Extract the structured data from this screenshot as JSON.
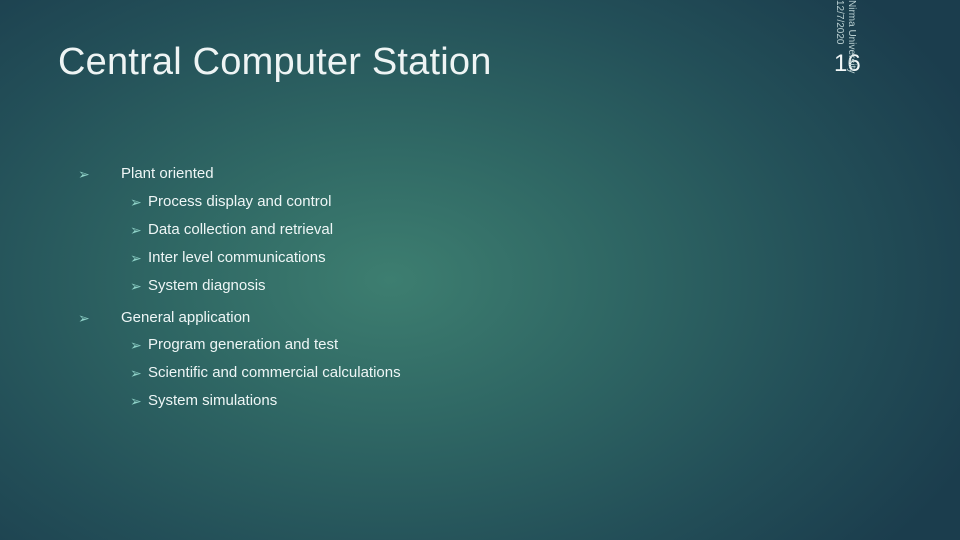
{
  "slide": {
    "title": "Central Computer Station",
    "slide_number": "16",
    "footer": {
      "organization": "Nirma University",
      "date": "12/7/2020"
    },
    "bullet_glyph": "➢",
    "bullets": [
      {
        "label": "Plant oriented",
        "children": [
          "Process display and control",
          "Data collection and retrieval",
          "Inter level communications",
          "System diagnosis"
        ]
      },
      {
        "label": "General application",
        "children": [
          "Program generation and test",
          "Scientific and commercial calculations",
          "System simulations"
        ]
      }
    ]
  },
  "colors": {
    "background_center": "#3d7e70",
    "background_edge": "#1b3d4d",
    "text": "#eef6f6",
    "bullet": "#8fd2c8",
    "footer_text": "#b9cfd1"
  }
}
